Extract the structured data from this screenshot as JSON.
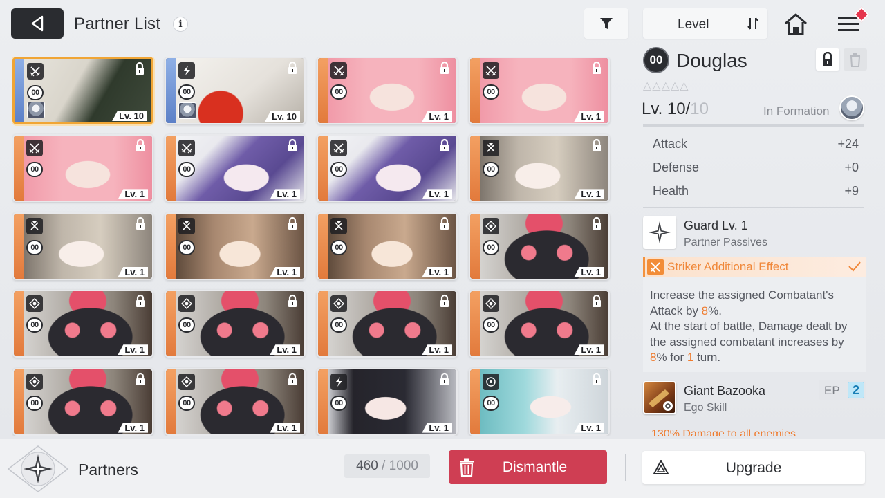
{
  "header": {
    "title": "Partner List",
    "info_glyph": "i",
    "sort_label": "Level"
  },
  "colors": {
    "selected_border": "#f0a535",
    "dismantle": "#cf3e53",
    "highlight": "#ef7b2e",
    "ep_badge": "#bfe7f8"
  },
  "partners": [
    {
      "art": "bear",
      "rarity": "blue",
      "class": "sword-icon",
      "tag": "00",
      "level": "Lv. 10",
      "selected": true,
      "assigned": true
    },
    {
      "art": "fox",
      "rarity": "blue",
      "class": "bolt-icon",
      "tag": "00",
      "level": "Lv. 10",
      "selected": false,
      "assigned": true
    },
    {
      "art": "pink",
      "rarity": "orange",
      "class": "sword-icon",
      "tag": "00",
      "level": "Lv. 1",
      "selected": false,
      "assigned": false
    },
    {
      "art": "pink",
      "rarity": "orange",
      "class": "sword-icon",
      "tag": "00",
      "level": "Lv. 1",
      "selected": false,
      "assigned": false
    },
    {
      "art": "pink",
      "rarity": "orange",
      "class": "sword-icon",
      "tag": "00",
      "level": "Lv. 1",
      "selected": false,
      "assigned": false
    },
    {
      "art": "purple",
      "rarity": "orange",
      "class": "sword-icon",
      "tag": "00",
      "level": "Lv. 1",
      "selected": false,
      "assigned": false
    },
    {
      "art": "purple",
      "rarity": "orange",
      "class": "sword-icon",
      "tag": "00",
      "level": "Lv. 1",
      "selected": false,
      "assigned": false
    },
    {
      "art": "silver",
      "rarity": "orange",
      "class": "shield-icon",
      "tag": "00",
      "level": "Lv. 1",
      "selected": false,
      "assigned": false
    },
    {
      "art": "silver",
      "rarity": "orange",
      "class": "shield-icon",
      "tag": "00",
      "level": "Lv. 1",
      "selected": false,
      "assigned": false
    },
    {
      "art": "brown",
      "rarity": "orange",
      "class": "shield-icon",
      "tag": "00",
      "level": "Lv. 1",
      "selected": false,
      "assigned": false
    },
    {
      "art": "brown",
      "rarity": "orange",
      "class": "shield-icon",
      "tag": "00",
      "level": "Lv. 1",
      "selected": false,
      "assigned": false
    },
    {
      "art": "blob",
      "rarity": "orange",
      "class": "target-icon",
      "tag": "00",
      "level": "Lv. 1",
      "selected": false,
      "assigned": false
    },
    {
      "art": "blob",
      "rarity": "orange",
      "class": "target-icon",
      "tag": "00",
      "level": "Lv. 1",
      "selected": false,
      "assigned": false
    },
    {
      "art": "blob",
      "rarity": "orange",
      "class": "target-icon",
      "tag": "00",
      "level": "Lv. 1",
      "selected": false,
      "assigned": false
    },
    {
      "art": "blob",
      "rarity": "orange",
      "class": "target-icon",
      "tag": "00",
      "level": "Lv. 1",
      "selected": false,
      "assigned": false
    },
    {
      "art": "blob",
      "rarity": "orange",
      "class": "target-icon",
      "tag": "00",
      "level": "Lv. 1",
      "selected": false,
      "assigned": false
    },
    {
      "art": "blob",
      "rarity": "orange",
      "class": "target-icon",
      "tag": "00",
      "level": "Lv. 1",
      "selected": false,
      "assigned": false
    },
    {
      "art": "blob",
      "rarity": "orange",
      "class": "target-icon",
      "tag": "00",
      "level": "Lv. 1",
      "selected": false,
      "assigned": false
    },
    {
      "art": "glasses",
      "rarity": "orange",
      "class": "bolt-icon",
      "tag": "00",
      "level": "Lv. 1",
      "selected": false,
      "assigned": false
    },
    {
      "art": "teal",
      "rarity": "orange",
      "class": "circle-icon",
      "tag": "00",
      "level": "Lv. 1",
      "selected": false,
      "assigned": false
    }
  ],
  "detail": {
    "tag": "00",
    "name": "Douglas",
    "stars": "△△△△△",
    "level_current": "Lv. 10/",
    "level_max": "10",
    "in_formation": "In Formation",
    "stats": [
      {
        "label": "Attack",
        "value": "+24"
      },
      {
        "label": "Defense",
        "value": "+0"
      },
      {
        "label": "Health",
        "value": "+9"
      }
    ],
    "passive": {
      "name": "Guard Lv. 1",
      "type": "Partner Passives"
    },
    "effect": {
      "label": "Striker Additional Effect",
      "desc_1": "Increase the assigned Combatant's Attack by ",
      "desc_1_value": "8",
      "desc_2": "%.",
      "desc_3": "At the start of battle, Damage dealt by the assigned combatant increases by ",
      "desc_3_value": "8",
      "desc_4": "% for ",
      "desc_4_value": "1",
      "desc_5": " turn."
    },
    "ego": {
      "name": "Giant Bazooka",
      "type": "Ego Skill",
      "ep_label": "EP",
      "ep_value": "2",
      "desc": "130% Damage to all enemies"
    }
  },
  "footer": {
    "label": "Partners",
    "count": "460",
    "count_sep": " / ",
    "count_total": "1000",
    "dismantle": "Dismantle",
    "upgrade": "Upgrade"
  }
}
